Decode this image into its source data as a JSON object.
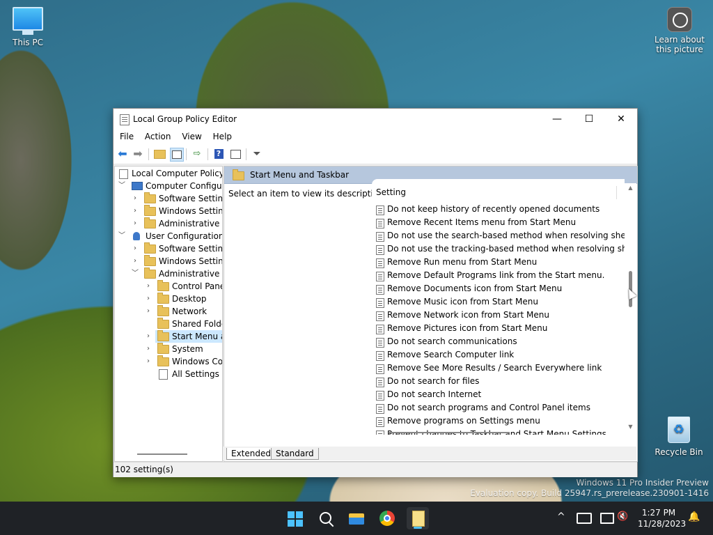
{
  "desktop": {
    "icons": {
      "this_pc": "This PC",
      "learn": "Learn about\nthis picture",
      "recycle_bin": "Recycle Bin"
    },
    "watermark": {
      "line1": "Windows 11 Pro Insider Preview",
      "line2": "Evaluation copy. Build 25947.rs_prerelease.230901-1416"
    }
  },
  "window": {
    "title": "Local Group Policy Editor",
    "controls": {
      "minimize": "—",
      "maximize": "☐",
      "close": "✕"
    },
    "menu": [
      "File",
      "Action",
      "View",
      "Help"
    ],
    "toolbar": [
      "back-arrow-icon",
      "forward-arrow-icon",
      "up-folder-icon",
      "show-hide-tree-icon",
      "export-list-icon",
      "help-icon",
      "properties-icon",
      "filter-icon"
    ],
    "tree": {
      "root": "Local Computer Policy",
      "computer_config": "Computer Configura",
      "cc_children": [
        "Software Settings",
        "Windows Setting",
        "Administrative Te"
      ],
      "user_config": "User Configuration",
      "uc_children": [
        "Software Settings",
        "Windows Setting",
        "Administrative Te"
      ],
      "admin_children": [
        "Control Panel",
        "Desktop",
        "Network",
        "Shared Folder",
        "Start Menu ar",
        "System",
        "Windows Cor",
        "All Settings"
      ]
    },
    "right": {
      "header": "Start Menu and Taskbar",
      "description": "Select an item to view its description.",
      "column_header": "Setting",
      "settings": [
        "Do not keep history of recently opened documents",
        "Remove Recent Items menu from Start Menu",
        "Do not use the search-based method when resolving shell s...",
        "Do not use the tracking-based method when resolving shell ...",
        "Remove Run menu from Start Menu",
        "Remove Default Programs link from the Start menu.",
        "Remove Documents icon from Start Menu",
        "Remove Music icon from Start Menu",
        "Remove Network icon from Start Menu",
        "Remove Pictures icon from Start Menu",
        "Do not search communications",
        "Remove Search Computer link",
        "Remove See More Results / Search Everywhere link",
        "Do not search for files",
        "Do not search Internet",
        "Do not search programs and Control Panel items",
        "Remove programs on Settings menu",
        "Prevent changes to Taskbar and Start Menu Settings"
      ]
    },
    "tabs": [
      "Extended",
      "Standard"
    ],
    "status": "102 setting(s)"
  },
  "taskbar": {
    "apps": [
      "start-icon",
      "search-icon",
      "file-explorer-icon",
      "chrome-icon",
      "notepad-icon"
    ],
    "time": "1:27 PM",
    "date": "11/28/2023",
    "tray_chevron": "^"
  }
}
